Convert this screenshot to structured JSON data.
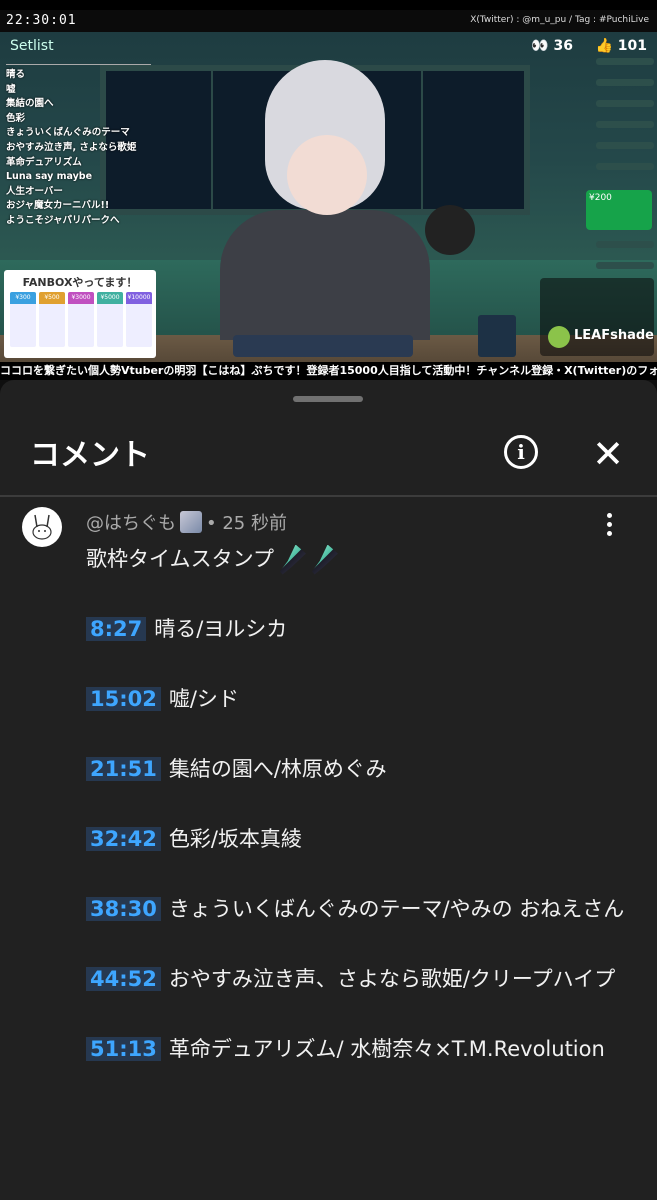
{
  "stream": {
    "clock": "22:30:01",
    "twitter_info": "X(Twitter) : @m_u_pu  /  Tag : #PuchiLive",
    "setlist_title": "Setlist",
    "setlist": [
      "晴る",
      "嘘",
      "集結の園へ",
      "色彩",
      "きょういくばんぐみのテーマ",
      "おやすみ泣き声, さよなら歌姫",
      "革命デュアリズム",
      "Luna say maybe",
      "人生オーバー",
      "おジャ魔女カーニバル!!",
      "ようこそジャパリパークへ"
    ],
    "viewers": "36",
    "likes": "101",
    "fanbox_title": "FANBOXやってます！",
    "fanbox_prices": [
      "¥300",
      "¥500",
      "¥3000",
      "¥5000",
      "¥10000"
    ],
    "superchat_amount": "¥200",
    "brand": "LEAFshade",
    "ticker": "ココロを繋ぎたい個人勢Vtuberの明羽【こはね】ぷちです！登録者15000人目指して活動中！チャンネル登録・X(Twitter)のフォロー"
  },
  "sheet": {
    "title": "コメント",
    "info_glyph": "i",
    "close_glyph": "✕"
  },
  "comment": {
    "author": "@はちぐも",
    "time": "• 25 秒前",
    "heading": "歌枠タイムスタンプ",
    "entries": [
      {
        "time": "8:27",
        "text": "晴る/ヨルシカ"
      },
      {
        "time": "15:02",
        "text": "嘘/シド"
      },
      {
        "time": "21:51",
        "text": "集結の園へ/林原めぐみ"
      },
      {
        "time": "32:42",
        "text": "色彩/坂本真綾"
      },
      {
        "time": "38:30",
        "text": "きょういくばんぐみのテーマ/やみの おねえさん"
      },
      {
        "time": "44:52",
        "text": "おやすみ泣き声、さよなら歌姫/クリープハイプ"
      },
      {
        "time": "51:13",
        "text": "革命デュアリズム/ 水樹奈々×T.M.Revolution"
      }
    ]
  }
}
